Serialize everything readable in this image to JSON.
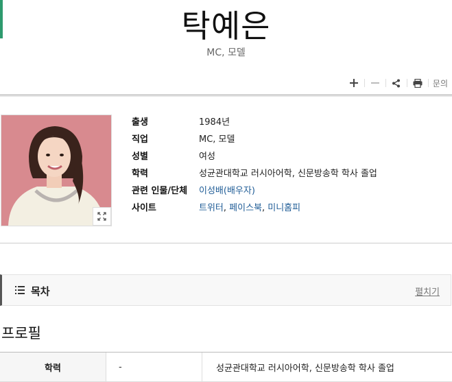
{
  "header": {
    "title": "탁예은",
    "subtitle": "MC, 모델"
  },
  "toolbar": {
    "report_label": "문의",
    "icons": [
      "plus-icon",
      "minus-icon",
      "share-icon",
      "print-icon"
    ]
  },
  "info": {
    "rows": [
      {
        "key": "출생",
        "value": "1984년"
      },
      {
        "key": "직업",
        "value": "MC, 모델"
      },
      {
        "key": "성별",
        "value": "여성"
      },
      {
        "key": "학력",
        "value": "성균관대학교 러시아어학, 신문방송학 학사 졸업"
      }
    ],
    "related": {
      "key": "관련 인물/단체",
      "link": "이성배(배우자)"
    },
    "sites": {
      "key": "사이트",
      "links": [
        "트위터",
        "페이스북",
        "미니홈피"
      ],
      "sep": ", "
    }
  },
  "toc": {
    "title": "목차",
    "toggle": "펼치기"
  },
  "profile": {
    "title": "프로필",
    "rows": [
      {
        "label": "학력",
        "period": "-",
        "value": "성균관대학교 러시아어학, 신문방송학 학사 졸업"
      }
    ]
  },
  "colors": {
    "accent": "#2e9a6e",
    "link": "#1f5c96"
  }
}
